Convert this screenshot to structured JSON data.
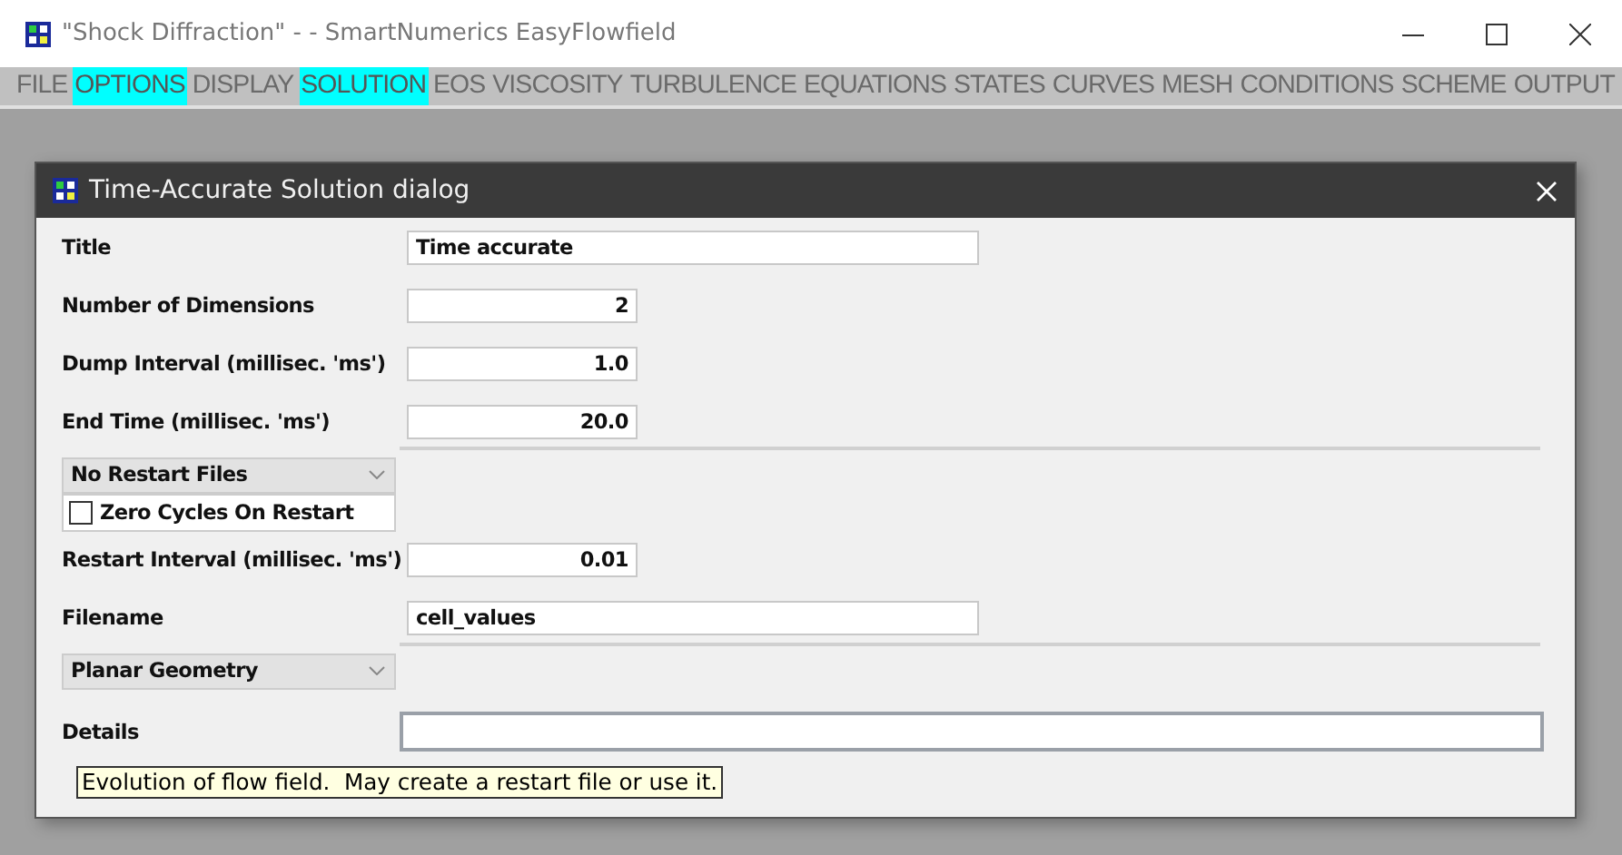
{
  "window": {
    "title": "\"Shock Diffraction\" -  - SmartNumerics EasyFlowfield"
  },
  "menu": [
    {
      "label": "FILE",
      "selected": false
    },
    {
      "label": "OPTIONS",
      "selected": true
    },
    {
      "label": "DISPLAY",
      "selected": false
    },
    {
      "label": "SOLUTION",
      "selected": true
    },
    {
      "label": "EOS",
      "selected": false
    },
    {
      "label": "VISCOSITY",
      "selected": false
    },
    {
      "label": "TURBULENCE",
      "selected": false
    },
    {
      "label": "EQUATIONS",
      "selected": false
    },
    {
      "label": "STATES",
      "selected": false
    },
    {
      "label": "CURVES",
      "selected": false
    },
    {
      "label": "MESH",
      "selected": false
    },
    {
      "label": "CONDITIONS",
      "selected": false
    },
    {
      "label": "SCHEME",
      "selected": false
    },
    {
      "label": "OUTPUT",
      "selected": false
    }
  ],
  "dialog": {
    "title": "Time-Accurate Solution dialog",
    "rows": [
      {
        "kind": "text",
        "label": "Title",
        "value": "Time accurate"
      },
      {
        "kind": "number",
        "label": "Number of Dimensions",
        "value": "2"
      },
      {
        "kind": "number",
        "label": "Dump Interval (millisec. 'ms')",
        "value": "1.0"
      },
      {
        "kind": "number",
        "label": "End Time (millisec. 'ms')",
        "value": "20.0"
      },
      {
        "kind": "separator"
      },
      {
        "kind": "dropdown",
        "value": "No Restart Files"
      },
      {
        "kind": "checkbox",
        "label": "Zero Cycles On Restart",
        "checked": false
      },
      {
        "kind": "number",
        "label": "Restart Interval (millisec. 'ms')",
        "value": "0.01"
      },
      {
        "kind": "text",
        "label": "Filename",
        "value": "cell_values"
      },
      {
        "kind": "separator"
      },
      {
        "kind": "dropdown",
        "value": "Planar Geometry"
      },
      {
        "kind": "memo",
        "label": "Details"
      }
    ],
    "tooltip": "Evolution of flow field.  May create a restart file or use it."
  }
}
